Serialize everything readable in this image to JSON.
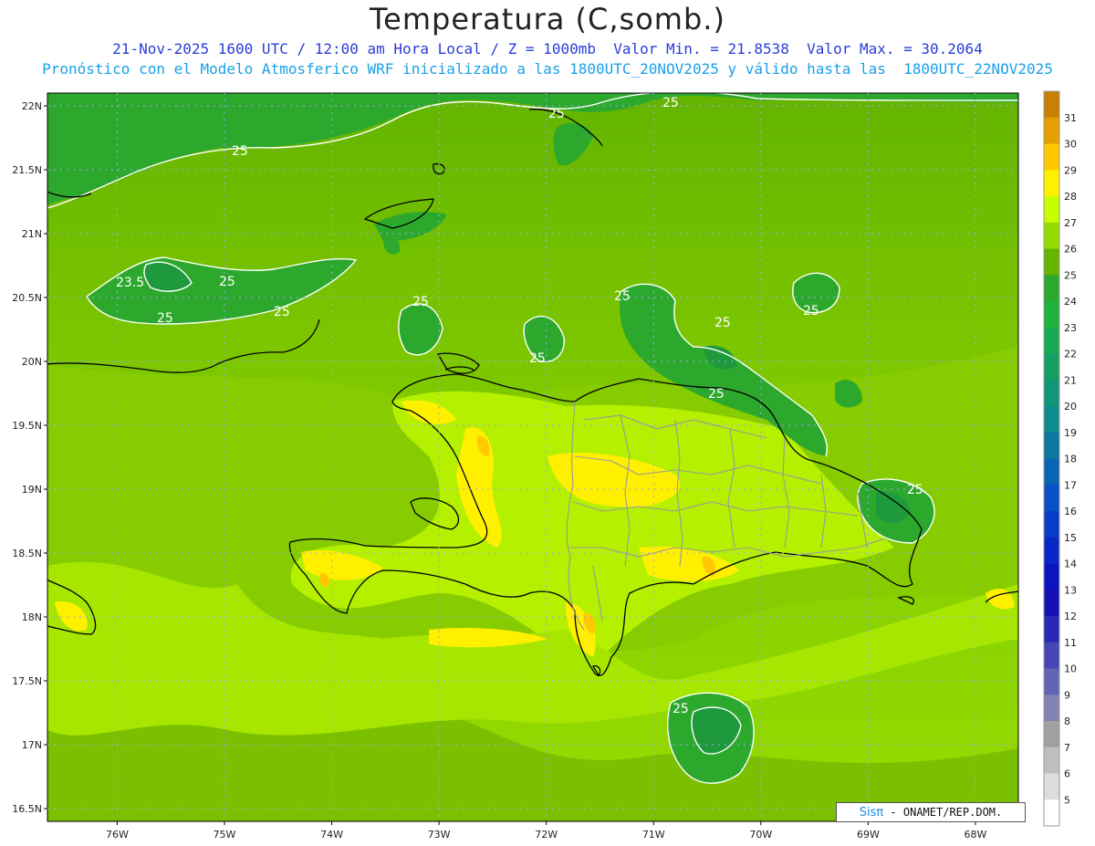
{
  "title": "Temperatura (C,somb.)",
  "subtitle_line1": "21-Nov-2025 1600 UTC / 12:00 am Hora Local / Z = 1000mb  Valor Min. = 21.8538  Valor Max. = 30.2064",
  "subtitle_line2": "Pronóstico con el Modelo Atmosferico WRF inicializado a las 1800UTC_20NOV2025 y válido hasta las  1800UTC_22NOV2025",
  "credit": {
    "brand": "Sisπ",
    "text": " - ONAMET/REP.DOM."
  },
  "axes": {
    "lat_labels": [
      "22N",
      "21.5N",
      "21N",
      "20.5N",
      "20N",
      "19.5N",
      "19N",
      "18.5N",
      "18N",
      "17.5N",
      "17N",
      "16.5N"
    ],
    "lon_labels": [
      "76W",
      "75W",
      "74W",
      "73W",
      "72W",
      "71W",
      "70W",
      "69W",
      "68W"
    ],
    "lat_range": [
      16.4,
      22.1
    ],
    "lon_range": [
      -76.65,
      -67.6
    ]
  },
  "contour_labels": [
    "25",
    "25",
    "25",
    "25",
    "25",
    "25",
    "23.5",
    "25",
    "25",
    "25",
    "25",
    "25",
    "25",
    "25",
    "25",
    "25"
  ],
  "legend": {
    "values": [
      "31",
      "30",
      "29",
      "28",
      "27",
      "26",
      "25",
      "24",
      "23",
      "22",
      "21",
      "20",
      "19",
      "18",
      "17",
      "16",
      "15",
      "14",
      "13",
      "12",
      "11",
      "10",
      "9",
      "8",
      "7",
      "6",
      "5"
    ],
    "colors": [
      "#c88000",
      "#e3a000",
      "#ffc800",
      "#fff000",
      "#c8ff00",
      "#96dc00",
      "#64b400",
      "#2ca82c",
      "#1eb43c",
      "#18aa50",
      "#14a064",
      "#109678",
      "#0e8c8c",
      "#0c78a0",
      "#0a64b4",
      "#0a50c8",
      "#0a3cc8",
      "#0a28c8",
      "#0a14c0",
      "#1410b4",
      "#2828b4",
      "#4646b4",
      "#6464b4",
      "#8282b4",
      "#a0a0a0",
      "#bebebe",
      "#dcdcdc",
      "#ffffff"
    ]
  }
}
